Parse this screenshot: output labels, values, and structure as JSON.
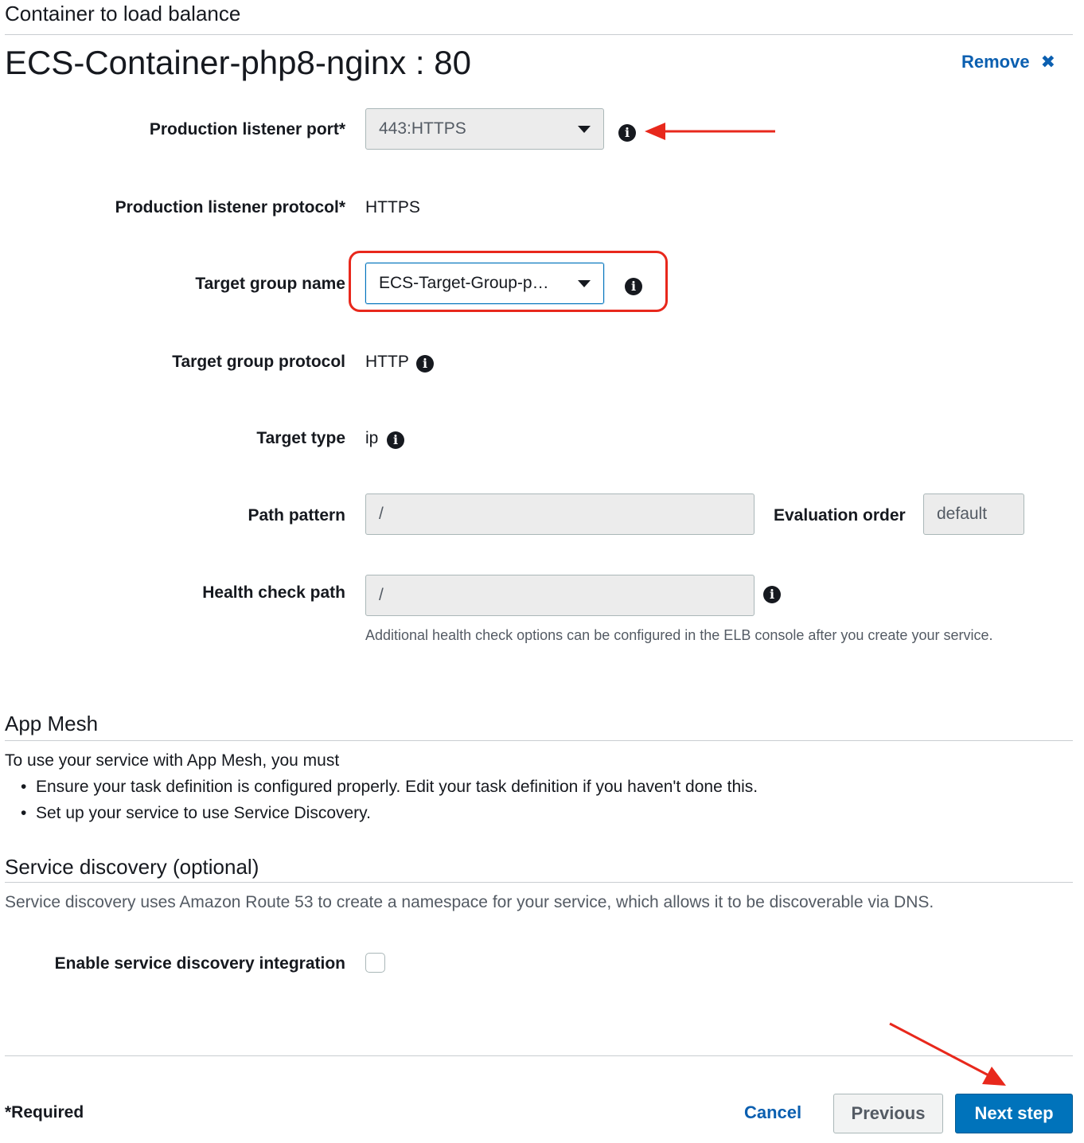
{
  "container_section": {
    "heading": "Container to load balance",
    "container_title": "ECS-Container-php8-nginx : 80",
    "remove_label": "Remove",
    "remove_icon": "close-icon"
  },
  "fields": {
    "production_listener_port": {
      "label": "Production listener port*",
      "value": "443:HTTPS"
    },
    "production_listener_protocol": {
      "label": "Production listener protocol*",
      "value": "HTTPS"
    },
    "target_group_name": {
      "label": "Target group name",
      "value": "ECS-Target-Group-p…"
    },
    "target_group_protocol": {
      "label": "Target group protocol",
      "value": "HTTP"
    },
    "target_type": {
      "label": "Target type",
      "value": "ip"
    },
    "path_pattern": {
      "label": "Path pattern",
      "value": "/"
    },
    "evaluation_order": {
      "label": "Evaluation order",
      "value": "default"
    },
    "health_check_path": {
      "label": "Health check path",
      "value": "/",
      "help": "Additional health check options can be configured in the ELB console after you create your service."
    }
  },
  "app_mesh": {
    "heading": "App Mesh",
    "intro": "To use your service with App Mesh, you must",
    "bullets": [
      "Ensure your task definition is configured properly. Edit your task definition if you haven't done this.",
      "Set up your service to use Service Discovery."
    ]
  },
  "service_discovery": {
    "heading": "Service discovery (optional)",
    "description": "Service discovery uses Amazon Route 53 to create a namespace for your service, which allows it to be discoverable via DNS.",
    "enable_label": "Enable service discovery integration",
    "enabled": false
  },
  "footer": {
    "required_note": "*Required",
    "cancel_label": "Cancel",
    "previous_label": "Previous",
    "next_label": "Next step"
  },
  "info_icon": "i",
  "colors": {
    "link": "#0b5fb0",
    "primary_button": "#0073bb",
    "annotation": "#e8281c"
  }
}
